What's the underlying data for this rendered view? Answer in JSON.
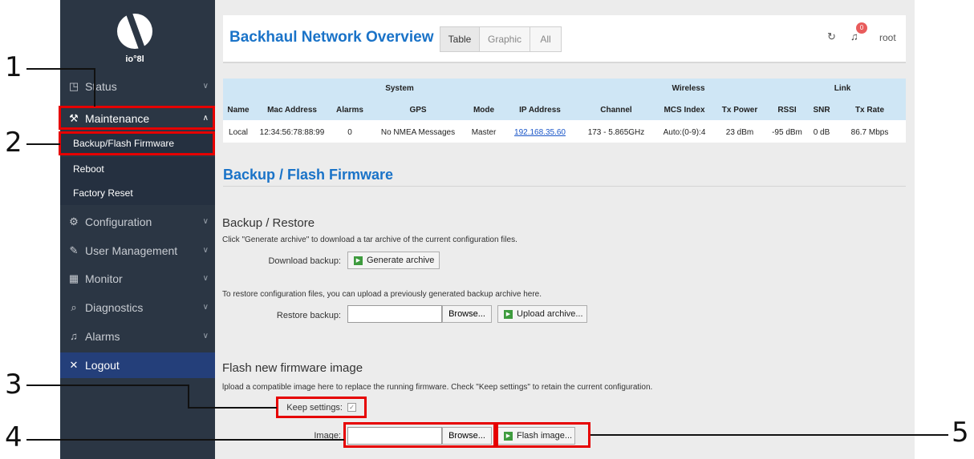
{
  "sidebar": {
    "logo_text": "io°8l",
    "items": [
      {
        "label": "Status",
        "icon": "chart-icon",
        "glyph": "◳"
      },
      {
        "label": "Maintenance",
        "icon": "wrench-icon",
        "glyph": "⚒"
      },
      {
        "label": "Configuration",
        "icon": "gear-icon",
        "glyph": "⚙"
      },
      {
        "label": "User Management",
        "icon": "pencil-icon",
        "glyph": "✎"
      },
      {
        "label": "Monitor",
        "icon": "grid-icon",
        "glyph": "▦"
      },
      {
        "label": "Diagnostics",
        "icon": "search-icon",
        "glyph": "⌕"
      },
      {
        "label": "Alarms",
        "icon": "bell-icon",
        "glyph": "♫"
      },
      {
        "label": "Logout",
        "icon": "close-icon",
        "glyph": "✕"
      }
    ],
    "subitems": [
      "Backup/Flash Firmware",
      "Reboot",
      "Factory Reset"
    ]
  },
  "header": {
    "title": "Backhaul Network Overview",
    "tabs": [
      "Table",
      "Graphic",
      "All"
    ],
    "notification_count": "0",
    "user": "root",
    "refresh_glyph": "↻",
    "bell_glyph": "♫"
  },
  "overview": {
    "groups": {
      "system": "System",
      "wireless": "Wireless",
      "link": "Link"
    },
    "columns": [
      "Name",
      "Mac Address",
      "Alarms",
      "GPS",
      "Mode",
      "IP Address",
      "Channel",
      "MCS Index",
      "Tx Power",
      "RSSI",
      "SNR",
      "Tx Rate"
    ],
    "row": [
      "Local",
      "12:34:56:78:88:99",
      "0",
      "No NMEA Messages",
      "Master",
      "192.168.35.60",
      "173 - 5.865GHz",
      "Auto:(0-9):4",
      "23 dBm",
      "-95 dBm",
      "0 dB",
      "86.7 Mbps"
    ]
  },
  "page": {
    "title": "Backup / Flash Firmware",
    "backup": {
      "heading": "Backup / Restore",
      "desc": "Click \"Generate archive\" to download a tar archive of the current configuration files.",
      "download_label": "Download backup:",
      "generate_button": "Generate archive",
      "restore_desc": "To restore configuration files, you can upload a previously generated backup archive here.",
      "restore_label": "Restore backup:",
      "browse": "Browse...",
      "upload_button": "Upload archive..."
    },
    "flash": {
      "heading": "Flash new firmware image",
      "desc": "lpload a compatible image here to replace the running firmware. Check \"Keep settings\" to retain the current configuration.",
      "keep_label": "Keep settings:",
      "keep_checked": true,
      "check_glyph": "✓",
      "image_label": "Image:",
      "browse": "Browse...",
      "flash_button": "Flash image..."
    }
  },
  "callouts": [
    "1",
    "2",
    "3",
    "4",
    "5"
  ],
  "colors": {
    "highlight": "#e60000",
    "accent": "#1a73c8",
    "sidebar": "#2b3644"
  }
}
